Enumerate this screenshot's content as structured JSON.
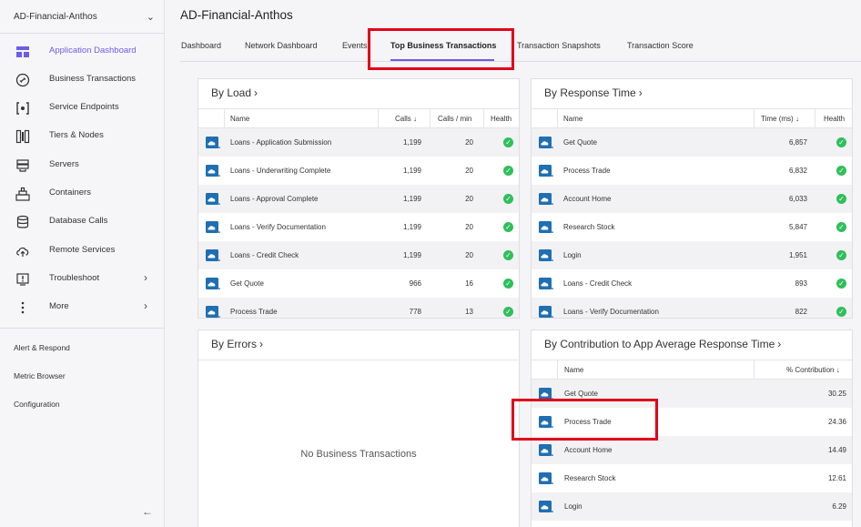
{
  "sidebar": {
    "app_name": "AD-Financial-Anthos",
    "items": [
      {
        "label": "Application Dashboard",
        "icon": "dashboard-icon",
        "active": true
      },
      {
        "label": "Business Transactions",
        "icon": "business-transactions-icon"
      },
      {
        "label": "Service Endpoints",
        "icon": "service-endpoints-icon"
      },
      {
        "label": "Tiers & Nodes",
        "icon": "tiers-nodes-icon"
      },
      {
        "label": "Servers",
        "icon": "servers-icon"
      },
      {
        "label": "Containers",
        "icon": "containers-icon"
      },
      {
        "label": "Database Calls",
        "icon": "database-icon"
      },
      {
        "label": "Remote Services",
        "icon": "cloud-upload-icon"
      },
      {
        "label": "Troubleshoot",
        "icon": "troubleshoot-icon"
      },
      {
        "label": "More",
        "icon": "more-icon"
      }
    ],
    "links": [
      "Alert & Respond",
      "Metric Browser",
      "Configuration"
    ]
  },
  "header": {
    "title": "AD-Financial-Anthos",
    "tabs": [
      "Dashboard",
      "Network Dashboard",
      "Events",
      "Top Business Transactions",
      "Transaction Snapshots",
      "Transaction Score"
    ],
    "active_tab": "Top Business Transactions"
  },
  "by_load": {
    "title": "By Load",
    "columns": [
      "Name",
      "Calls",
      "Calls / min",
      "Health"
    ],
    "rows": [
      {
        "name": "Loans - Application Submission",
        "calls": "1,199",
        "cpm": "20"
      },
      {
        "name": "Loans - Underwriting Complete",
        "calls": "1,199",
        "cpm": "20"
      },
      {
        "name": "Loans - Approval Complete",
        "calls": "1,199",
        "cpm": "20"
      },
      {
        "name": "Loans - Verify Documentation",
        "calls": "1,199",
        "cpm": "20"
      },
      {
        "name": "Loans - Credit Check",
        "calls": "1,199",
        "cpm": "20"
      },
      {
        "name": "Get Quote",
        "calls": "966",
        "cpm": "16"
      },
      {
        "name": "Process Trade",
        "calls": "778",
        "cpm": "13"
      }
    ]
  },
  "by_response_time": {
    "title": "By Response Time",
    "columns": [
      "Name",
      "Time (ms)",
      "Health"
    ],
    "rows": [
      {
        "name": "Get Quote",
        "time": "6,857"
      },
      {
        "name": "Process Trade",
        "time": "6,832"
      },
      {
        "name": "Account Home",
        "time": "6,033"
      },
      {
        "name": "Research Stock",
        "time": "5,847"
      },
      {
        "name": "Login",
        "time": "1,951"
      },
      {
        "name": "Loans - Credit Check",
        "time": "893"
      },
      {
        "name": "Loans - Verify Documentation",
        "time": "822"
      }
    ]
  },
  "by_errors": {
    "title": "By Errors",
    "empty_message": "No Business Transactions"
  },
  "by_contribution": {
    "title": "By Contribution to App Average Response Time",
    "columns": [
      "Name",
      "% Contribution"
    ],
    "rows": [
      {
        "name": "Get Quote",
        "pct": "30.25"
      },
      {
        "name": "Process Trade",
        "pct": "24.36"
      },
      {
        "name": "Account Home",
        "pct": "14.49"
      },
      {
        "name": "Research Stock",
        "pct": "12.61"
      },
      {
        "name": "Login",
        "pct": "6.29"
      }
    ]
  },
  "colors": {
    "accent": "#6c5ce7",
    "health_ok": "#2fbf5b",
    "highlight": "#e0001b",
    "bt_icon": "#1f6fb2"
  }
}
